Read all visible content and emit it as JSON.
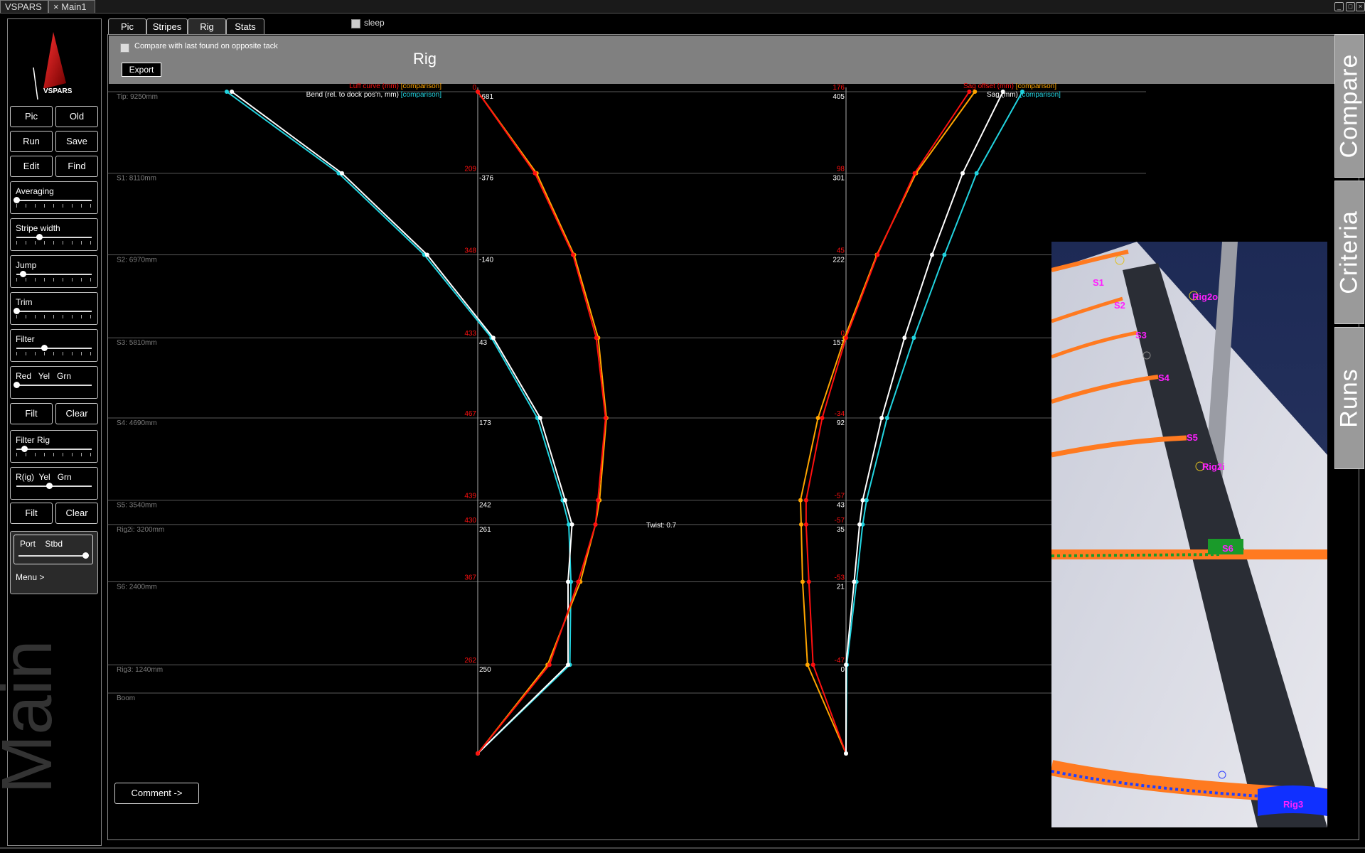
{
  "window": {
    "tabs": [
      "VSPARS",
      "× Main1"
    ],
    "buttons": [
      "_",
      "□",
      "×"
    ]
  },
  "left_panel": {
    "logo": "VSPARS",
    "buttons": [
      [
        "Pic",
        "Old"
      ],
      [
        "Run",
        "Save"
      ],
      [
        "Edit",
        "Find"
      ]
    ],
    "sliders": [
      {
        "label": "Averaging",
        "value": 0.0
      },
      {
        "label": "Stripe width",
        "value": 0.3
      },
      {
        "label": "Jump",
        "value": 0.08
      },
      {
        "label": "Trim",
        "value": 0.0
      },
      {
        "label": "Filter",
        "value": 0.37
      },
      {
        "label": "Red   Yel   Grn",
        "value": 0.0
      }
    ],
    "buttons2": [
      "Filt",
      "Clear"
    ],
    "sliders2": [
      {
        "label": "Filter Rig",
        "value": 0.1
      },
      {
        "label": "R(ig)  Yel   Grn",
        "value": 0.43
      }
    ],
    "buttons3": [
      "Filt",
      "Clear"
    ],
    "port_stbd": {
      "label": "Port    Stbd",
      "value": 1.0
    },
    "menu": "Menu >",
    "main_label": "Main"
  },
  "tabs": [
    "Pic",
    "Stripes",
    "Rig",
    "Stats"
  ],
  "sleep_label": "sleep",
  "header": {
    "compare_label": "Compare with last found on opposite tack",
    "export": "Export",
    "title": "Rig"
  },
  "side_tabs": [
    "Compare",
    "Criteria",
    "Runs"
  ],
  "comment_button": "Comment ->",
  "colors": {
    "white": "#ffffff",
    "cyan": "#22d4e0",
    "red": "#ff1010",
    "orange": "#ffa500",
    "grid": "#5a5a5a",
    "rowlabel": "#7c7c7c"
  },
  "chart_data": {
    "type": "line",
    "twist": "Twist: 0.7",
    "rows": [
      {
        "name": "Tip: 9250mm",
        "bend": "-681",
        "luff": "0",
        "sag": "405",
        "sag_offset": "176"
      },
      {
        "name": "S1: 8110mm",
        "bend": "-376",
        "luff": "209",
        "sag": "301",
        "sag_offset": "98"
      },
      {
        "name": "S2: 6970mm",
        "bend": "-140",
        "luff": "348",
        "sag": "222",
        "sag_offset": "45"
      },
      {
        "name": "S3: 5810mm",
        "bend": "43",
        "luff": "433",
        "sag": "151",
        "sag_offset": "0"
      },
      {
        "name": "S4: 4690mm",
        "bend": "173",
        "luff": "467",
        "sag": "92",
        "sag_offset": "-34"
      },
      {
        "name": "S5: 3540mm",
        "bend": "242",
        "luff": "439",
        "sag": "43",
        "sag_offset": "-57"
      },
      {
        "name": "Rig2i: 3200mm",
        "bend": "261",
        "luff": "430",
        "sag": "35",
        "sag_offset": "-57"
      },
      {
        "name": "S6: 2400mm",
        "bend": "",
        "luff": "367",
        "sag": "21",
        "sag_offset": "-53"
      },
      {
        "name": "Rig3: 1240mm",
        "bend": "250",
        "luff": "262",
        "sag": "0",
        "sag_offset": "-47"
      },
      {
        "name": "Boom",
        "bend": "",
        "luff": "",
        "sag": "",
        "sag_offset": ""
      }
    ],
    "heights": [
      9250,
      8110,
      6970,
      5810,
      4690,
      3540,
      3200,
      2400,
      1240,
      0
    ],
    "legends": {
      "luff": "Luff curve (mm)",
      "bend": "Bend (rel. to dock pos'n, mm)",
      "sag_offset": "Sag offset (mm)",
      "sag": "Sag (mm)",
      "comparison": "[comparison]"
    },
    "series": [
      {
        "name": "Bend",
        "color": "#ffffff",
        "points": [
          [
            -681,
            9250
          ],
          [
            -376,
            8110
          ],
          [
            -140,
            6970
          ],
          [
            43,
            5810
          ],
          [
            173,
            4690
          ],
          [
            242,
            3540
          ],
          [
            261,
            3200
          ],
          [
            250,
            2400
          ],
          [
            250,
            1240
          ],
          [
            0,
            0
          ]
        ]
      },
      {
        "name": "Bend [comparison]",
        "color": "#22d4e0",
        "points": [
          [
            -695,
            9250
          ],
          [
            -385,
            8110
          ],
          [
            -148,
            6970
          ],
          [
            38,
            5810
          ],
          [
            165,
            4690
          ],
          [
            235,
            3540
          ],
          [
            252,
            3200
          ],
          [
            258,
            2400
          ],
          [
            255,
            1240
          ],
          [
            0,
            0
          ]
        ]
      },
      {
        "name": "Luff curve",
        "color": "#ff1010",
        "points": [
          [
            0,
            9250
          ],
          [
            209,
            8110
          ],
          [
            348,
            6970
          ],
          [
            433,
            5810
          ],
          [
            467,
            4690
          ],
          [
            439,
            3540
          ],
          [
            430,
            3200
          ],
          [
            367,
            2400
          ],
          [
            262,
            1240
          ],
          [
            0,
            0
          ]
        ]
      },
      {
        "name": "Luff curve [comparison]",
        "color": "#ffa500",
        "points": [
          [
            0,
            9250
          ],
          [
            215,
            8110
          ],
          [
            352,
            6970
          ],
          [
            440,
            5810
          ],
          [
            470,
            4690
          ],
          [
            445,
            3540
          ],
          [
            430,
            3200
          ],
          [
            375,
            2400
          ],
          [
            255,
            1240
          ],
          [
            0,
            0
          ]
        ]
      },
      {
        "name": "Sag offset",
        "color": "#ff1010",
        "points": [
          [
            176,
            9250
          ],
          [
            98,
            8110
          ],
          [
            45,
            6970
          ],
          [
            0,
            5810
          ],
          [
            -34,
            4690
          ],
          [
            -57,
            3540
          ],
          [
            -57,
            3200
          ],
          [
            -53,
            2400
          ],
          [
            -47,
            1240
          ],
          [
            0,
            0
          ]
        ]
      },
      {
        "name": "Sag offset [comparison]",
        "color": "#ffa500",
        "points": [
          [
            184,
            9250
          ],
          [
            100,
            8110
          ],
          [
            44,
            6970
          ],
          [
            -2,
            5810
          ],
          [
            -40,
            4690
          ],
          [
            -65,
            3540
          ],
          [
            -64,
            3200
          ],
          [
            -62,
            2400
          ],
          [
            -55,
            1240
          ],
          [
            0,
            0
          ]
        ]
      },
      {
        "name": "Sag",
        "color": "#ffffff",
        "points": [
          [
            405,
            9250
          ],
          [
            301,
            8110
          ],
          [
            222,
            6970
          ],
          [
            151,
            5810
          ],
          [
            92,
            4690
          ],
          [
            43,
            3540
          ],
          [
            35,
            3200
          ],
          [
            21,
            2400
          ],
          [
            0,
            1240
          ],
          [
            0,
            0
          ]
        ]
      },
      {
        "name": "Sag [comparison]",
        "color": "#22d4e0",
        "points": [
          [
            455,
            9250
          ],
          [
            337,
            8110
          ],
          [
            254,
            6970
          ],
          [
            175,
            5810
          ],
          [
            106,
            4690
          ],
          [
            53,
            3540
          ],
          [
            43,
            3200
          ],
          [
            27,
            2400
          ],
          [
            2,
            1240
          ],
          [
            0,
            0
          ]
        ]
      }
    ]
  },
  "photo": {
    "stripe_labels": [
      "S1",
      "S2",
      "S3",
      "S4",
      "S5",
      "Rig2i",
      "S6",
      "Rig3",
      "Rig2o"
    ]
  }
}
